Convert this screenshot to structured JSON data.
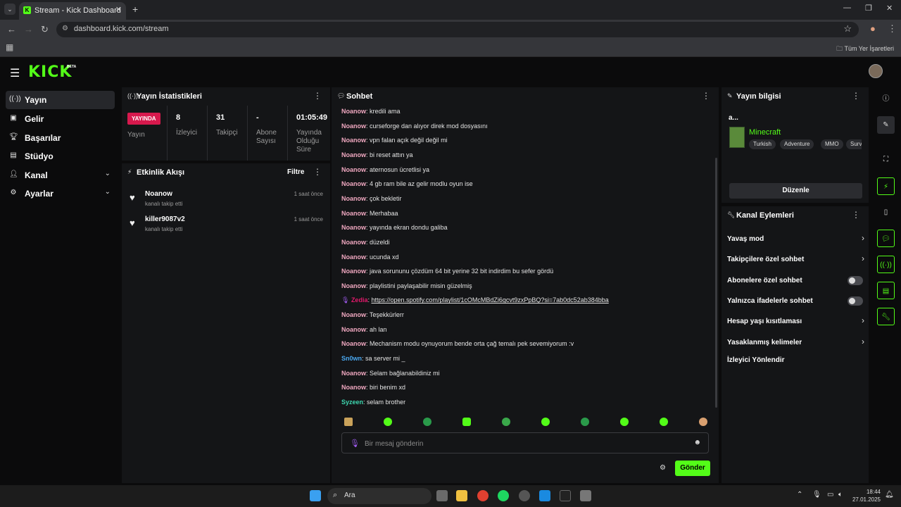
{
  "browser": {
    "tab_title": "Stream - Kick Dashboard",
    "url": "dashboard.kick.com/stream",
    "bookmarks_label": "Tüm Yer İşaretleri"
  },
  "brand": {
    "logo": "KICK",
    "beta": "BETA",
    "accent": "#53fc18"
  },
  "sidebar": {
    "items": [
      {
        "label": "Yayın",
        "icon": "broadcast-icon"
      },
      {
        "label": "Gelir",
        "icon": "revenue-icon"
      },
      {
        "label": "Başarılar",
        "icon": "trophy-icon"
      },
      {
        "label": "Stüdyo",
        "icon": "studio-icon"
      },
      {
        "label": "Kanal",
        "icon": "user-icon"
      },
      {
        "label": "Ayarlar",
        "icon": "gear-icon"
      }
    ]
  },
  "stats": {
    "title": "Yayın İstatistikleri",
    "live_badge": "YAYINDA",
    "live_caption": "Yayın",
    "items": [
      {
        "value": "8",
        "caption": "İzleyici"
      },
      {
        "value": "31",
        "caption": "Takipçi"
      },
      {
        "value": "-",
        "caption": "Abone Sayısı"
      },
      {
        "value": "01:05:49",
        "caption": "Yayında Olduğu Süre"
      }
    ]
  },
  "activity": {
    "title": "Etkinlik Akışı",
    "filter": "Filtre",
    "items": [
      {
        "name": "Noanow",
        "sub": "kanalı takip etti",
        "time": "1 saat önce"
      },
      {
        "name": "killer9087v2",
        "sub": "kanalı takip etti",
        "time": "1 saat önce"
      }
    ]
  },
  "chat": {
    "title": "Sohbet",
    "messages": [
      {
        "user": "Noanow",
        "color": "#f0a8c0",
        "text": "kredili ama"
      },
      {
        "user": "Noanow",
        "color": "#f0a8c0",
        "text": "curseforge dan alıyor direk mod dosyasını"
      },
      {
        "user": "Noanow",
        "color": "#f0a8c0",
        "text": "vpn falan açık değil değil mi"
      },
      {
        "user": "Noanow",
        "color": "#f0a8c0",
        "text": "bi reset attın ya"
      },
      {
        "user": "Noanow",
        "color": "#f0a8c0",
        "text": "aternosun ücretlisi ya"
      },
      {
        "user": "Noanow",
        "color": "#f0a8c0",
        "text": "4 gb ram bile az gelir modlu oyun ise"
      },
      {
        "user": "Noanow",
        "color": "#f0a8c0",
        "text": "çok bekletir"
      },
      {
        "user": "Noanow",
        "color": "#f0a8c0",
        "text": "Merhabaa"
      },
      {
        "user": "Noanow",
        "color": "#f0a8c0",
        "text": "yayında ekran dondu galiba"
      },
      {
        "user": "Noanow",
        "color": "#f0a8c0",
        "text": "düzeldi"
      },
      {
        "user": "Noanow",
        "color": "#f0a8c0",
        "text": "ucunda xd"
      },
      {
        "user": "Noanow",
        "color": "#f0a8c0",
        "text": "java sorununu çözdüm 64 bit yerine 32 bit indirdim bu sefer gördü"
      },
      {
        "user": "Noanow",
        "color": "#f0a8c0",
        "text": "playlistini paylaşabilir misin güzelmiş"
      },
      {
        "user": "Zedia",
        "color": "#e2196b",
        "text": "https://open.spotify.com/playlist/1cOMcMBdZi6gcvt9zxPpBQ?si=7ab0dc52ab384bba",
        "link": true,
        "badge": true
      },
      {
        "user": "Noanow",
        "color": "#f0a8c0",
        "text": "Teşekkürlerr"
      },
      {
        "user": "Noanow",
        "color": "#f0a8c0",
        "text": "ah lan"
      },
      {
        "user": "Noanow",
        "color": "#f0a8c0",
        "text": "Mechanism modu oynuyorum bende orta çağ temalı pek sevemiyorum :v"
      },
      {
        "user": "Sn0wn",
        "color": "#4aa8f0",
        "text": "sa server mi _"
      },
      {
        "user": "Noanow",
        "color": "#f0a8c0",
        "text": "Selam bağlanabildiniz mi"
      },
      {
        "user": "Noanow",
        "color": "#f0a8c0",
        "text": "biri benim xd"
      },
      {
        "user": "Syzeen",
        "color": "#3ed8b0",
        "text": "selam brother"
      }
    ],
    "placeholder": "Bir mesaj gönderin",
    "send_label": "Gönder"
  },
  "stream_info": {
    "title": "Yayın bilgisi",
    "stream_title": "a...",
    "game": "Minecraft",
    "tags": [
      "Turkish",
      "Adventure",
      "MMO",
      "Surv"
    ],
    "edit_label": "Düzenle"
  },
  "channel_actions": {
    "title": "Kanal Eylemleri",
    "items": [
      {
        "label": "Yavaş mod",
        "kind": "chevron"
      },
      {
        "label": "Takipçilere özel sohbet",
        "kind": "chevron"
      },
      {
        "label": "Abonelere özel sohbet",
        "kind": "toggle",
        "on": false
      },
      {
        "label": "Yalnızca ifadelerle sohbet",
        "kind": "toggle",
        "on": false
      },
      {
        "label": "Hesap yaşı kısıtlaması",
        "kind": "chevron"
      },
      {
        "label": "Yasaklanmış kelimeler",
        "kind": "chevron"
      },
      {
        "label": "İzleyici Yönlendir",
        "kind": "none"
      }
    ]
  },
  "taskbar": {
    "search_label": "Ara",
    "time": "18:44",
    "date": "27.01.2025"
  }
}
